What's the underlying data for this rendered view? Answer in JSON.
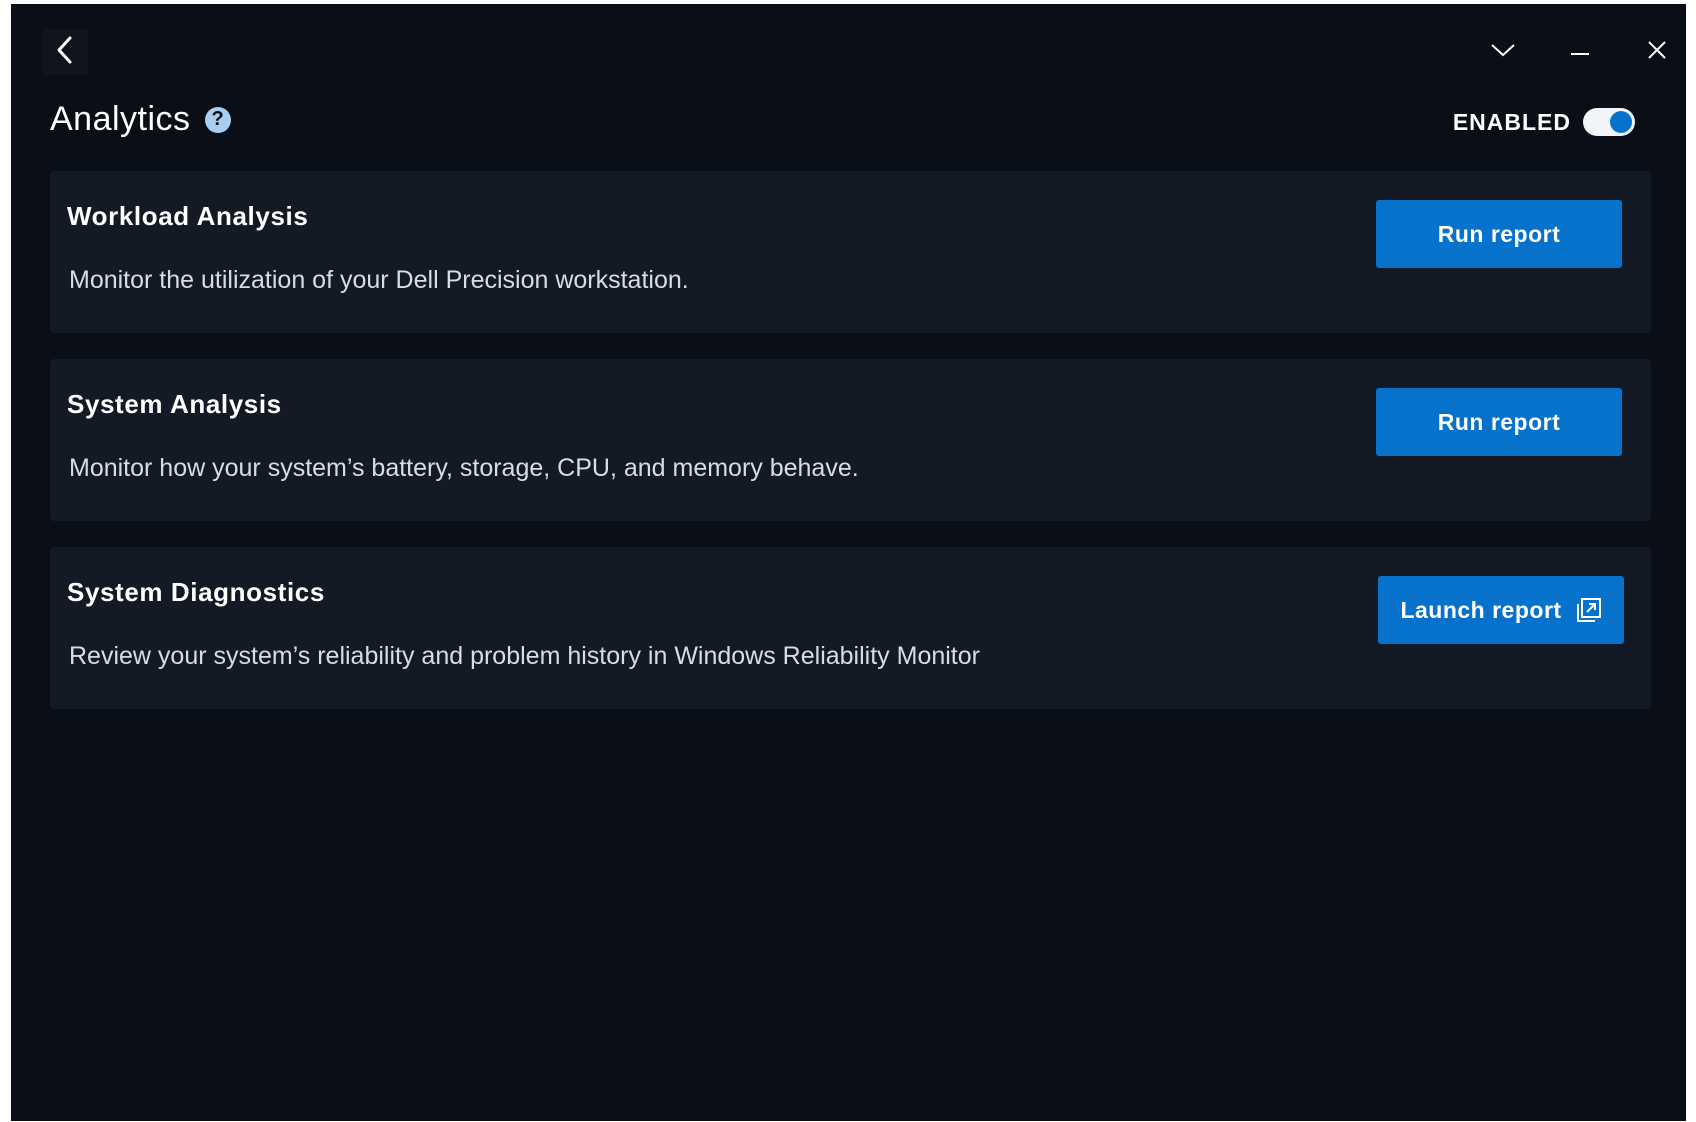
{
  "header": {
    "title": "Analytics",
    "help_icon": "question-circle-icon",
    "enabled_label": "ENABLED",
    "toggle_on": true
  },
  "window_controls": {
    "back_icon": "chevron-left-icon",
    "dropdown_icon": "chevron-down-icon",
    "minimize_icon": "minimize-icon",
    "close_icon": "close-icon"
  },
  "cards": [
    {
      "title": "Workload Analysis",
      "description": "Monitor the utilization of your Dell Precision workstation.",
      "button_label": "Run report"
    },
    {
      "title": "System Analysis",
      "description": "Monitor how your system’s battery, storage, CPU, and memory behave.",
      "button_label": "Run report"
    },
    {
      "title": "System Diagnostics",
      "description": "Review your system’s reliability and problem history in Windows Reliability Monitor",
      "button_label": "Launch report",
      "button_icon": "external-link-icon"
    }
  ],
  "colors": {
    "background": "#0a0e16",
    "card": "#131a25",
    "accent": "#0672cb",
    "help": "#a8cff2"
  }
}
